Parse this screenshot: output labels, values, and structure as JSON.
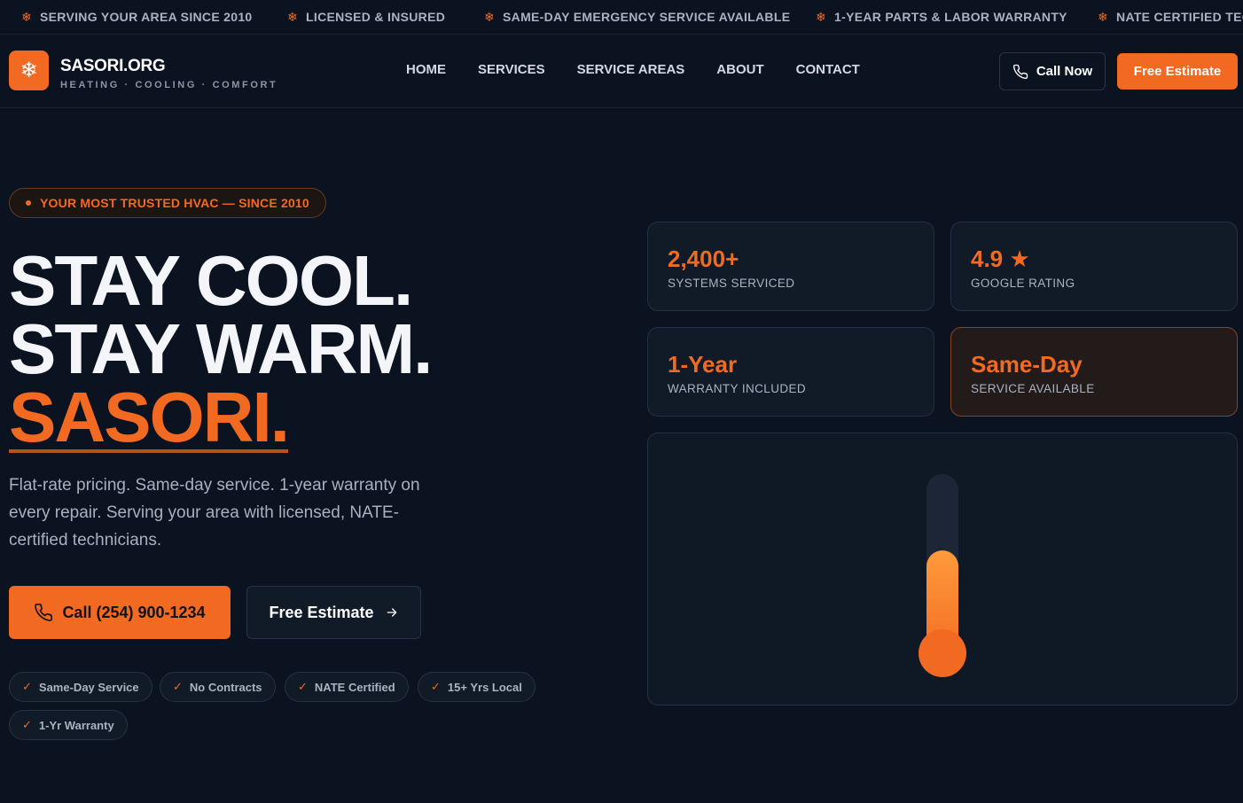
{
  "ticker": [
    {
      "icon": "snowflake-icon",
      "text": "SERVING YOUR AREA SINCE 2010"
    },
    {
      "icon": "snowflake-icon",
      "text": "LICENSED & INSURED"
    },
    {
      "icon": "snowflake-icon",
      "text": "SAME-DAY EMERGENCY SERVICE AVAILABLE"
    },
    {
      "icon": "snowflake-icon",
      "text": "1-YEAR PARTS & LABOR WARRANTY"
    },
    {
      "icon": "snowflake-icon",
      "text": "NATE CERTIFIED TECHNICIANS"
    }
  ],
  "brand": {
    "name": "SASORI.ORG",
    "tagline": "HEATING · COOLING · COMFORT",
    "icon": "snowflake-icon"
  },
  "nav": {
    "links": [
      "HOME",
      "SERVICES",
      "SERVICE AREAS",
      "ABOUT",
      "CONTACT"
    ],
    "call_label": "Call Now",
    "estimate_label": "Free Estimate"
  },
  "hero": {
    "pill": "YOUR MOST TRUSTED HVAC — SINCE 2010",
    "line1": "STAY COOL.",
    "line2": "STAY WARM.",
    "line3": "SASORI.",
    "subtext": "Flat-rate pricing. Same-day service. 1-year warranty on every repair. Serving your area with licensed, NATE-certified technicians.",
    "call_label": "Call (254) 900-1234",
    "estimate_label": "Free Estimate",
    "chips": [
      "Same-Day Service",
      "No Contracts",
      "NATE Certified",
      "15+ Yrs Local",
      "1-Yr Warranty"
    ]
  },
  "stats": [
    {
      "value": "2,400+",
      "label": "SYSTEMS SERVICED"
    },
    {
      "value": "4.9 ★",
      "label": "GOOGLE RATING"
    },
    {
      "value": "1-Year",
      "label": "WARRANTY INCLUDED"
    },
    {
      "value": "Same-Day",
      "label": "SERVICE AVAILABLE"
    }
  ],
  "thermometer": {
    "fill_fraction": 0.6
  },
  "colors": {
    "accent": "#f26a22",
    "background": "#0b1220",
    "card": "#111a27"
  }
}
